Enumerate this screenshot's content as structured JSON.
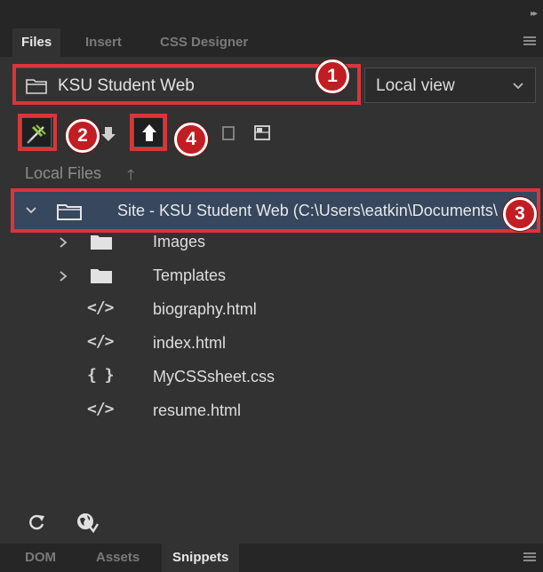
{
  "panel_tabs": {
    "files": "Files",
    "insert": "Insert",
    "css_designer": "CSS Designer"
  },
  "site_selector": {
    "value": "KSU Student Web"
  },
  "view_selector": {
    "value": "Local view"
  },
  "file_list_header": {
    "label": "Local Files"
  },
  "site_root": {
    "label": "Site - KSU Student Web (C:\\Users\\eatkin\\Documents\\"
  },
  "files": [
    {
      "type": "folder",
      "name": "Images"
    },
    {
      "type": "folder",
      "name": "Templates"
    },
    {
      "type": "html",
      "icon_text": "</>",
      "name": "biography.html"
    },
    {
      "type": "html",
      "icon_text": "</>",
      "name": "index.html"
    },
    {
      "type": "css",
      "icon_text": "{ }",
      "name": "MyCSSsheet.css"
    },
    {
      "type": "html",
      "icon_text": "</>",
      "name": "resume.html"
    }
  ],
  "callouts": [
    "1",
    "2",
    "3",
    "4"
  ],
  "bottom_tabs": {
    "dom": "DOM",
    "assets": "Assets",
    "snippets": "Snippets"
  },
  "colors": {
    "panel_bg": "#323232",
    "tab_bar_bg": "#262626",
    "selected_row_bg": "#36475e",
    "callout_red": "#c21d22",
    "connect_icon_green": "#8fc63f"
  },
  "icons": {
    "site_selector": "folder-icon",
    "connect": "connect-plug-icon",
    "get": "get-down-arrow-icon",
    "put": "put-up-arrow-icon",
    "sync": "expand-panel-icon",
    "refresh": "refresh-icon",
    "browser": "globe-preview-icon"
  }
}
